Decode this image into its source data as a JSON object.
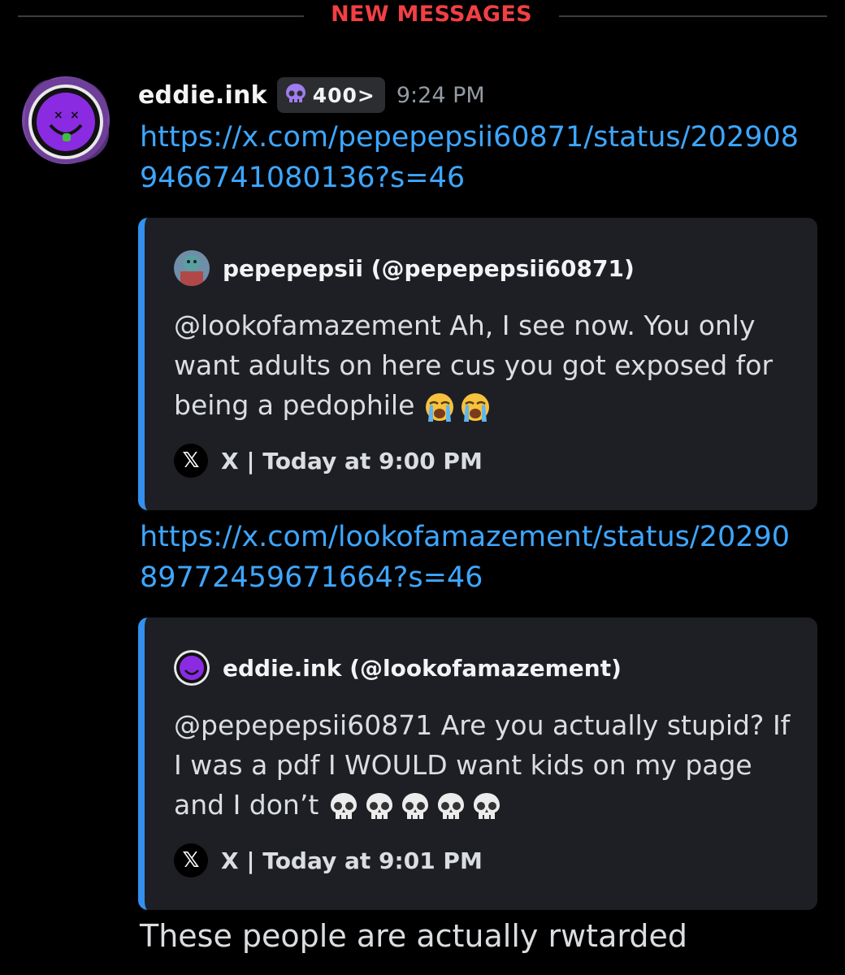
{
  "divider": {
    "label": "NEW MESSAGES"
  },
  "message": {
    "username": "eddie.ink",
    "tag": "400>",
    "timestamp": "9:24 PM",
    "link1": "https://x.com/pepepepsii60871/status/2029089466741080136?s=46",
    "link2": "https://x.com/lookofamazement/status/2029089772459671664?s=46",
    "text": "These people are actually rwtarded"
  },
  "embeds": [
    {
      "author": "pepepepsii (@pepepepsii60871)",
      "description": "@lookofamazement Ah, I see now. You only want adults on here cus you got exposed for being a pedophile",
      "emoji": [
        "loudly-crying-face",
        "loudly-crying-face"
      ],
      "footer": "X | Today at 9:00 PM"
    },
    {
      "author": "eddie.ink (@lookofamazement)",
      "description": "@pepepepsii60871 Are you actually stupid? If I was a pdf I WOULD want kids on my page and I don’t",
      "emoji": [
        "skull",
        "skull",
        "skull",
        "skull",
        "skull"
      ],
      "footer": "X | Today at 9:01 PM"
    }
  ],
  "colors": {
    "link": "#3ea6ff",
    "embed_bar": "#3390ee",
    "new_messages": "#f23f43",
    "accent_purple": "#8a2be2"
  }
}
